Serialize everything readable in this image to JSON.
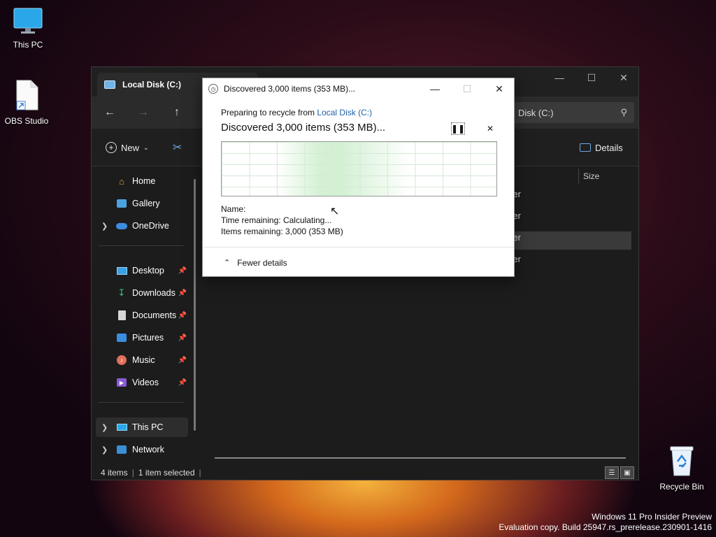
{
  "desktop": {
    "icons": [
      {
        "label": "This PC"
      },
      {
        "label": "OBS Studio"
      },
      {
        "label": "Recycle Bin"
      }
    ],
    "watermark": {
      "line1": "Windows 11 Pro Insider Preview",
      "line2": "Evaluation copy. Build 25947.rs_prerelease.230901-1416"
    }
  },
  "explorer": {
    "tab_title": "Local Disk (C:)",
    "address_text": "Disk (C:)",
    "toolbar": {
      "new_label": "New",
      "details_label": "Details"
    },
    "nav": {
      "home": "Home",
      "gallery": "Gallery",
      "onedrive": "OneDrive",
      "desktop": "Desktop",
      "downloads": "Downloads",
      "documents": "Documents",
      "pictures": "Pictures",
      "music": "Music",
      "videos": "Videos",
      "this_pc": "This PC",
      "network": "Network"
    },
    "columns": {
      "size": "Size"
    },
    "rows": [
      "older",
      "older",
      "older",
      "older"
    ],
    "status": {
      "items": "4 items",
      "selected": "1 item selected"
    }
  },
  "dialog": {
    "title": "Discovered 3,000 items (353 MB)...",
    "preparing_prefix": "Preparing to recycle from",
    "source_link": "Local Disk (C:)",
    "headline": "Discovered 3,000 items (353 MB)...",
    "name_label": "Name:",
    "time_label": "Time remaining:",
    "time_value": "Calculating...",
    "items_label": "Items remaining:",
    "items_value": "3,000 (353 MB)",
    "fewer_details": "Fewer details"
  }
}
